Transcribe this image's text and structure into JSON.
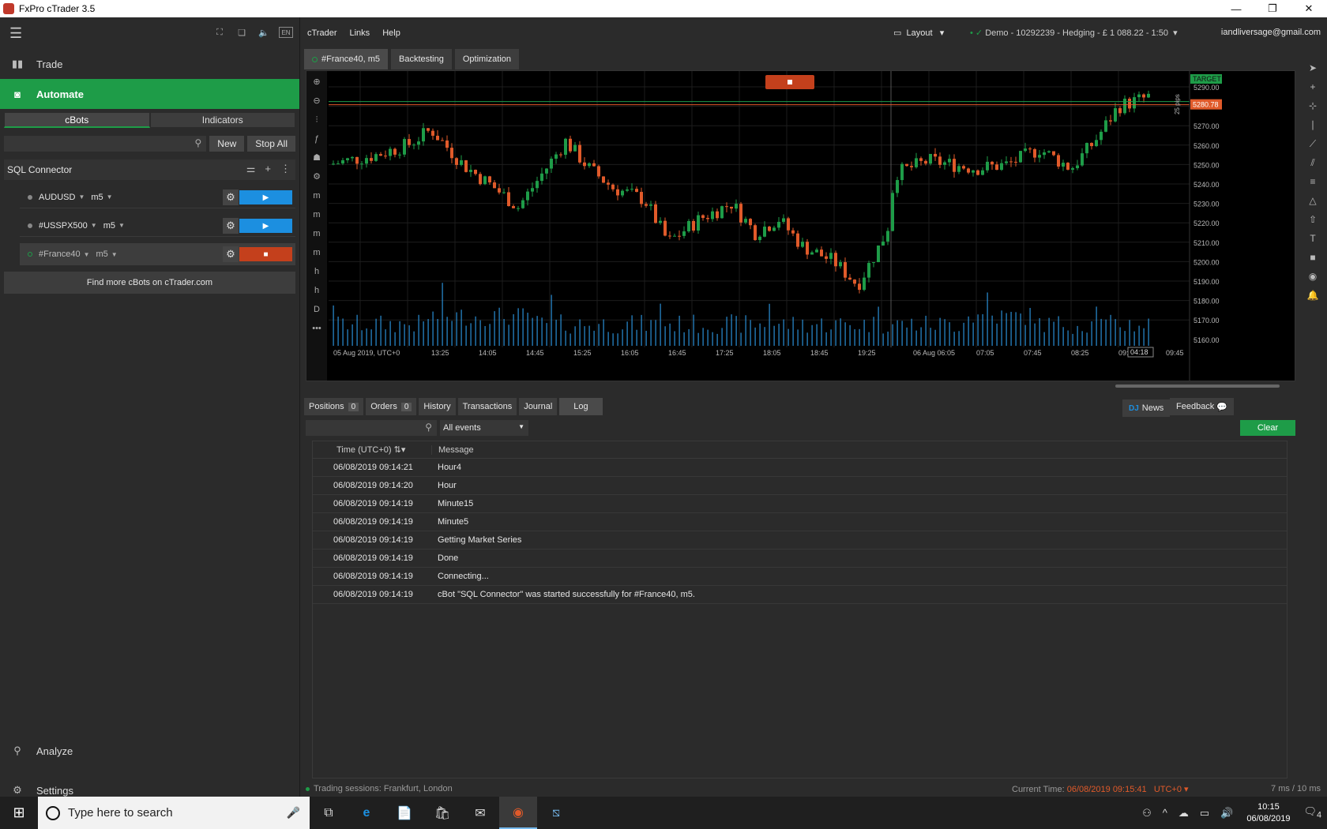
{
  "window": {
    "title": "FxPro cTrader 3.5",
    "min": "—",
    "max": "❐",
    "close": "✕"
  },
  "left": {
    "toolbar_icons": [
      "⛶",
      "❏",
      "🔈",
      "EN"
    ],
    "nav": {
      "trade": "Trade",
      "automate": "Automate",
      "analyze": "Analyze",
      "settings": "Settings"
    },
    "subtabs": {
      "cbots": "cBots",
      "indicators": "Indicators"
    },
    "buttons": {
      "new": "New",
      "stop_all": "Stop All"
    },
    "group_name": "SQL Connector",
    "bots": [
      {
        "symbol": "AUDUSD",
        "tf": "m5",
        "state": "run"
      },
      {
        "symbol": "#USSPX500",
        "tf": "m5",
        "state": "run"
      },
      {
        "symbol": "#France40",
        "tf": "m5",
        "state": "stop"
      }
    ],
    "find_more": "Find more cBots on cTrader.com"
  },
  "menu": {
    "ctrader": "cTrader",
    "links": "Links",
    "help": "Help",
    "layout": "Layout",
    "account": "Demo  - 10292239 - Hedging - £ 1 088.22 - 1:50",
    "email": "iandliversage@gmail.com"
  },
  "chart_tabs": {
    "chart": "#France40, m5",
    "backtesting": "Backtesting",
    "optimization": "Optimization"
  },
  "chart": {
    "price_labels": [
      "5290.00",
      "5270.00",
      "5260.00",
      "5250.00",
      "5240.00",
      "5230.00",
      "5220.00",
      "5210.00",
      "5200.00",
      "5190.00",
      "5180.00",
      "5170.00",
      "5160.00"
    ],
    "current_price": "5280.78",
    "target_label": "TARGET",
    "pips_label": "25 pips",
    "countdown": "04:18",
    "time_labels": [
      "05 Aug 2019, UTC+0",
      "13:25",
      "14:05",
      "14:45",
      "15:25",
      "16:05",
      "16:45",
      "17:25",
      "18:05",
      "18:45",
      "19:25",
      "06 Aug 06:05",
      "07:05",
      "07:45",
      "08:25",
      "09:05",
      "09:45"
    ],
    "up_color": "#1e9c48",
    "down_color": "#e05a2a",
    "volume_color": "#2a8fd6"
  },
  "bottom_tabs": {
    "positions": "Positions",
    "positions_count": "0",
    "orders": "Orders",
    "orders_count": "0",
    "history": "History",
    "transactions": "Transactions",
    "journal": "Journal",
    "log": "Log",
    "news": "News",
    "feedback": "Feedback"
  },
  "log": {
    "filter": "All events",
    "clear": "Clear",
    "col_time": "Time (UTC+0)",
    "col_message": "Message",
    "rows": [
      {
        "time": "06/08/2019 09:14:21",
        "msg": "Hour4"
      },
      {
        "time": "06/08/2019 09:14:20",
        "msg": "Hour"
      },
      {
        "time": "06/08/2019 09:14:19",
        "msg": "Minute15"
      },
      {
        "time": "06/08/2019 09:14:19",
        "msg": "Minute5"
      },
      {
        "time": "06/08/2019 09:14:19",
        "msg": "Getting Market Series"
      },
      {
        "time": "06/08/2019 09:14:19",
        "msg": "Done"
      },
      {
        "time": "06/08/2019 09:14:19",
        "msg": "Connecting..."
      },
      {
        "time": "06/08/2019 09:14:19",
        "msg": "cBot \"SQL Connector\" was started successfully for #France40, m5."
      }
    ]
  },
  "status": {
    "sessions": "Trading sessions:  Frankfurt, London",
    "current_time_label": "Current Time:",
    "current_time": "06/08/2019 09:15:41",
    "tz": "UTC+0 ▾",
    "latency": "7 ms / 10 ms"
  },
  "taskbar": {
    "search_placeholder": "Type here to search",
    "time": "10:15",
    "date": "06/08/2019",
    "notif": "4"
  }
}
